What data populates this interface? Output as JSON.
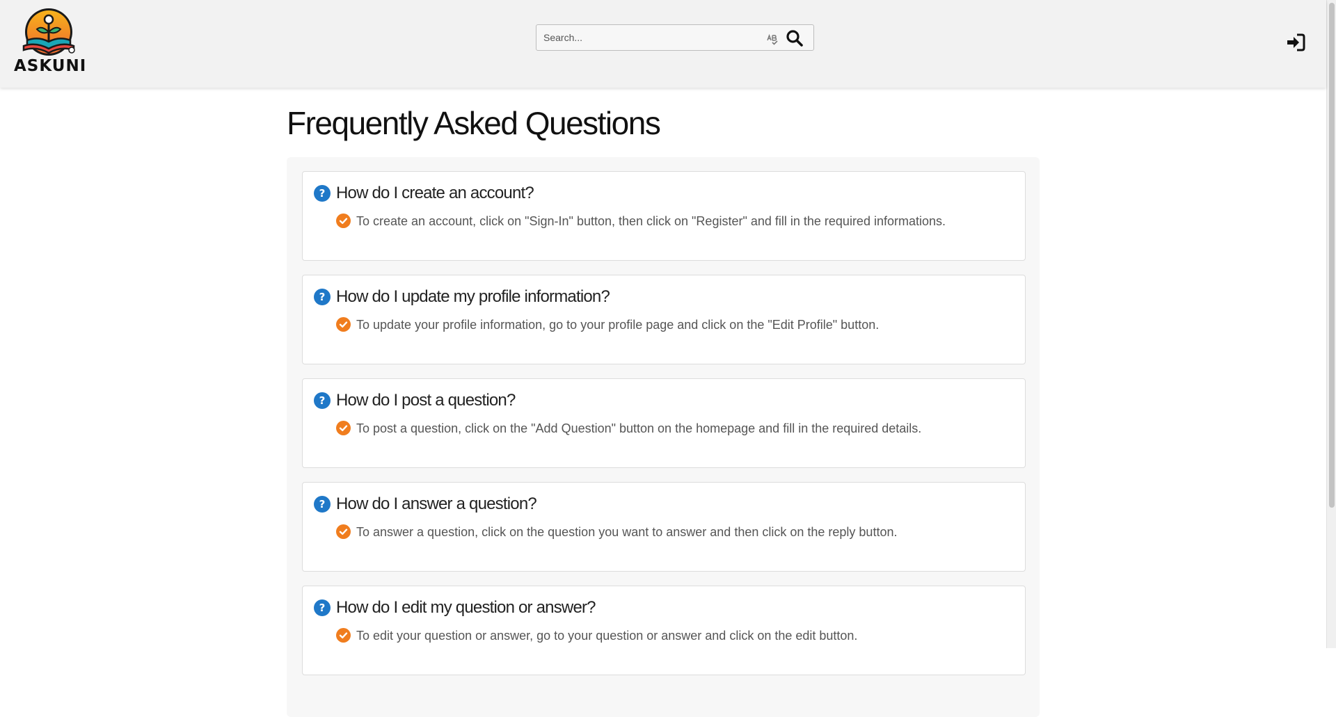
{
  "header": {
    "logo_text": "ASKUNI",
    "search": {
      "placeholder": "Search...",
      "value": ""
    }
  },
  "page": {
    "title": "Frequently Asked Questions"
  },
  "faqs": [
    {
      "question": "How do I create an account?",
      "answer": "To create an account, click on \"Sign-In\" button, then click on \"Register\" and fill in the required informations."
    },
    {
      "question": "How do I update my profile information?",
      "answer": "To update your profile information, go to your profile page and click on the \"Edit Profile\" button."
    },
    {
      "question": "How do I post a question?",
      "answer": "To post a question, click on the \"Add Question\" button on the homepage and fill in the required details."
    },
    {
      "question": "How do I answer a question?",
      "answer": "To answer a question, click on the question you want to answer and then click on the reply button."
    },
    {
      "question": "How do I edit my question or answer?",
      "answer": "To edit your question or answer, go to your question or answer and click on the edit button."
    }
  ],
  "colors": {
    "question_icon": "#1f78c8",
    "answer_icon": "#f07d1e",
    "header_bg": "#f2f2f2",
    "panel_bg": "#f7f7f7"
  },
  "icons": {
    "logo": "book-sprout-logo-icon",
    "spellcheck": "spellcheck-icon",
    "search": "search-icon",
    "signin": "sign-in-icon",
    "question": "question-circle-icon",
    "answer": "check-circle-icon"
  }
}
